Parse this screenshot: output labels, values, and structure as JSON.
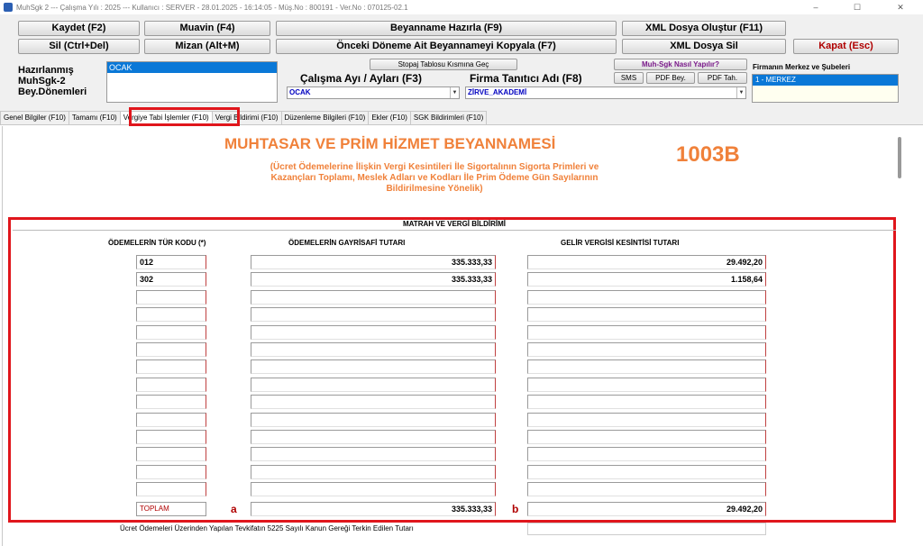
{
  "window": {
    "title": "MuhSgk 2  ---  Çalışma Yılı : 2025  ---  Kullanıcı : SERVER - 28.01.2025 - 16:14:05 - Müş.No : 800191 - Ver.No : 070125-02.1",
    "minimize": "–",
    "maximize": "☐",
    "close": "✕"
  },
  "toolbar": {
    "save": "Kaydet (F2)",
    "delete": "Sil (Ctrl+Del)",
    "ledger": "Muavin (F4)",
    "trial_balance": "Mizan (Alt+M)",
    "prepare_declaration": "Beyanname Hazırla (F9)",
    "copy_previous": "Önceki Döneme Ait Beyannameyi Kopyala (F7)",
    "create_xml": "XML Dosya Oluştur (F11)",
    "delete_xml": "XML Dosya Sil",
    "close": "Kapat (Esc)"
  },
  "left_panel": {
    "label_line1": "Hazırlanmış",
    "label_line2": "MuhSgk-2",
    "label_line3": "Bey.Dönemleri",
    "selected_period": "OCAK"
  },
  "stopaj_button": "Stopaj Tablosu Kısmına Geç",
  "work_month": {
    "label": "Çalışma Ayı / Ayları (F3)",
    "value": "OCAK"
  },
  "company": {
    "label": "Firma Tanıtıcı Adı (F8)",
    "value": "ZİRVE_AKADEMİ"
  },
  "help_link": "Muh-Sgk Nasıl Yapılır?",
  "small_buttons": {
    "sms": "SMS",
    "pdf_bey": "PDF Bey.",
    "pdf_tah": "PDF Tah."
  },
  "branches": {
    "label": "Firmanın Merkez ve Şubeleri",
    "selected": "1 - MERKEZ"
  },
  "tabs": [
    {
      "label": "Genel Bilgiler (F10)"
    },
    {
      "label": "Tamamı (F10)"
    },
    {
      "label": "Vergiye Tabi İşlemler (F10)"
    },
    {
      "label": "Vergi Bildirimi (F10)"
    },
    {
      "label": "Düzenleme Bilgileri (F10)"
    },
    {
      "label": "Ekler (F10)"
    },
    {
      "label": "SGK Bildirimleri (F10)"
    }
  ],
  "form": {
    "title": "MUHTASAR VE PRİM HİZMET BEYANNAMESİ",
    "code": "1003B",
    "subtitle": "(Ücret Ödemelerine İlişkin Vergi Kesintileri İle Sigortalının Sigorta Primleri ve Kazançları Toplamı, Meslek Adları ve Kodları İle Prim Ödeme Gün Sayılarının Bildirilmesine Yönelik)",
    "section_title": "MATRAH VE VERGİ BİLDİRİMİ",
    "col_type_code": "ÖDEMELERİN TÜR KODU (*)",
    "col_gross": "ÖDEMELERİN GAYRİSAFİ TUTARI",
    "col_tax": "GELİR VERGİSİ KESİNTİSİ TUTARI",
    "rows": [
      {
        "code": "012",
        "gross": "335.333,33",
        "tax": "29.492,20"
      },
      {
        "code": "302",
        "gross": "335.333,33",
        "tax": "1.158,64"
      },
      {
        "code": "",
        "gross": "",
        "tax": ""
      },
      {
        "code": "",
        "gross": "",
        "tax": ""
      },
      {
        "code": "",
        "gross": "",
        "tax": ""
      },
      {
        "code": "",
        "gross": "",
        "tax": ""
      },
      {
        "code": "",
        "gross": "",
        "tax": ""
      },
      {
        "code": "",
        "gross": "",
        "tax": ""
      },
      {
        "code": "",
        "gross": "",
        "tax": ""
      },
      {
        "code": "",
        "gross": "",
        "tax": ""
      },
      {
        "code": "",
        "gross": "",
        "tax": ""
      },
      {
        "code": "",
        "gross": "",
        "tax": ""
      },
      {
        "code": "",
        "gross": "",
        "tax": ""
      },
      {
        "code": "",
        "gross": "",
        "tax": ""
      }
    ],
    "total_label": "TOPLAM",
    "total_gross": "335.333,33",
    "total_tax": "29.492,20",
    "mark_a": "a",
    "mark_b": "b",
    "footer_text": "Ücret Ödemeleri Üzerinden Yapılan Tevkifatın 5225 Sayılı Kanun Gereği Terkin Edilen Tutarı"
  },
  "colors": {
    "accent_orange": "#f0813a",
    "highlight_red": "#e0161c",
    "selection_blue": "#0a78d7"
  }
}
